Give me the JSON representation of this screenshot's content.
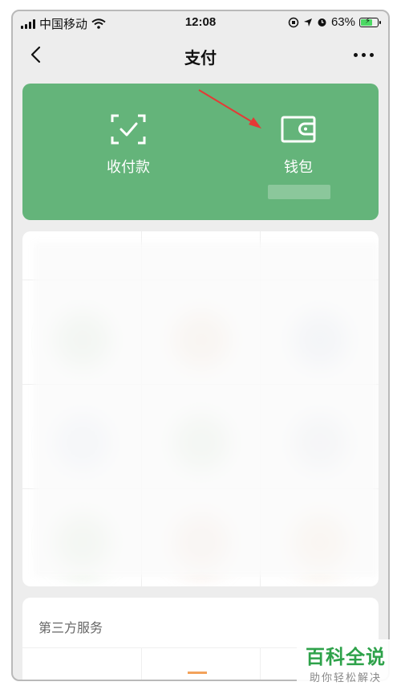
{
  "status_bar": {
    "carrier": "中国移动",
    "time": "12:08",
    "battery": "63%"
  },
  "nav": {
    "title": "支付"
  },
  "payment_card": {
    "items": [
      {
        "label": "收付款",
        "icon": "scan-qr-icon"
      },
      {
        "label": "钱包",
        "icon": "wallet-icon"
      }
    ]
  },
  "third_party": {
    "title": "第三方服务"
  },
  "watermark": {
    "title": "百科全说",
    "subtitle": "助你轻松解决"
  },
  "colors": {
    "green": "#64b47a",
    "background": "#ededed",
    "arrow": "#e53935",
    "watermark_green": "#2ea24a"
  }
}
